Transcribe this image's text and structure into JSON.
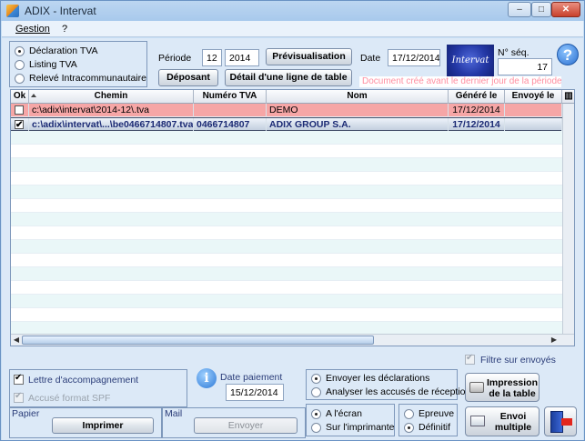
{
  "window": {
    "title": "ADIX - Intervat",
    "minimize": "–",
    "maximize": "□",
    "close": "✕"
  },
  "menu": {
    "gestion": "Gestion",
    "help": "?"
  },
  "declaration_type": {
    "options": [
      "Déclaration TVA",
      "Listing TVA",
      "Relevé Intracommunautaire"
    ],
    "selected": 0
  },
  "periode": {
    "label": "Période",
    "month": "12",
    "year": "2014"
  },
  "buttons": {
    "previsualisation": "Prévisualisation",
    "deposant": "Déposant",
    "detail": "Détail d'une ligne de table",
    "imprimer": "Imprimer",
    "envoyer": "Envoyer",
    "impression_table": "Impression de la table",
    "envoi_multiple": "Envoi multiple"
  },
  "date": {
    "label": "Date",
    "value": "17/12/2014"
  },
  "logo": {
    "text": "Intervat"
  },
  "nseq": {
    "label": "N° séq.",
    "value": "17"
  },
  "warning": "Document créé avant le dernier jour de la période",
  "table": {
    "columns": [
      "Ok",
      "Chemin",
      "Numéro TVA",
      "Nom",
      "Généré le",
      "Envoyé le"
    ],
    "rows": [
      {
        "ok": false,
        "chemin": "c:\\adix\\intervat\\2014-12\\.tva",
        "numero": "",
        "nom": "DEMO",
        "genere": "17/12/2014",
        "envoye": "",
        "style": "pink"
      },
      {
        "ok": true,
        "chemin": "c:\\adix\\intervat\\...\\be0466714807.tva",
        "numero": "0466714807",
        "nom": "ADIX GROUP S.A.",
        "genere": "17/12/2014",
        "envoye": "",
        "style": "sel"
      }
    ],
    "empty_rows": 15
  },
  "filtre": {
    "label": "Filtre sur envoyés",
    "checked": true
  },
  "lettre": {
    "label": "Lettre d'accompagnement",
    "checked": true
  },
  "accuse": {
    "label": "Accusé format SPF",
    "checked": true
  },
  "date_paiement": {
    "label": "Date paiement",
    "value": "15/12/2014"
  },
  "sections": {
    "papier": "Papier",
    "mail": "Mail"
  },
  "envoi_options": {
    "options": [
      "Envoyer les déclarations",
      "Analyser les accusés de réception"
    ],
    "selected": 0
  },
  "output_options": {
    "options": [
      "A l'écran",
      "Sur l'imprimante"
    ],
    "selected": 0
  },
  "mode_options": {
    "options": [
      "Epreuve",
      "Définitif"
    ],
    "selected": 1
  }
}
